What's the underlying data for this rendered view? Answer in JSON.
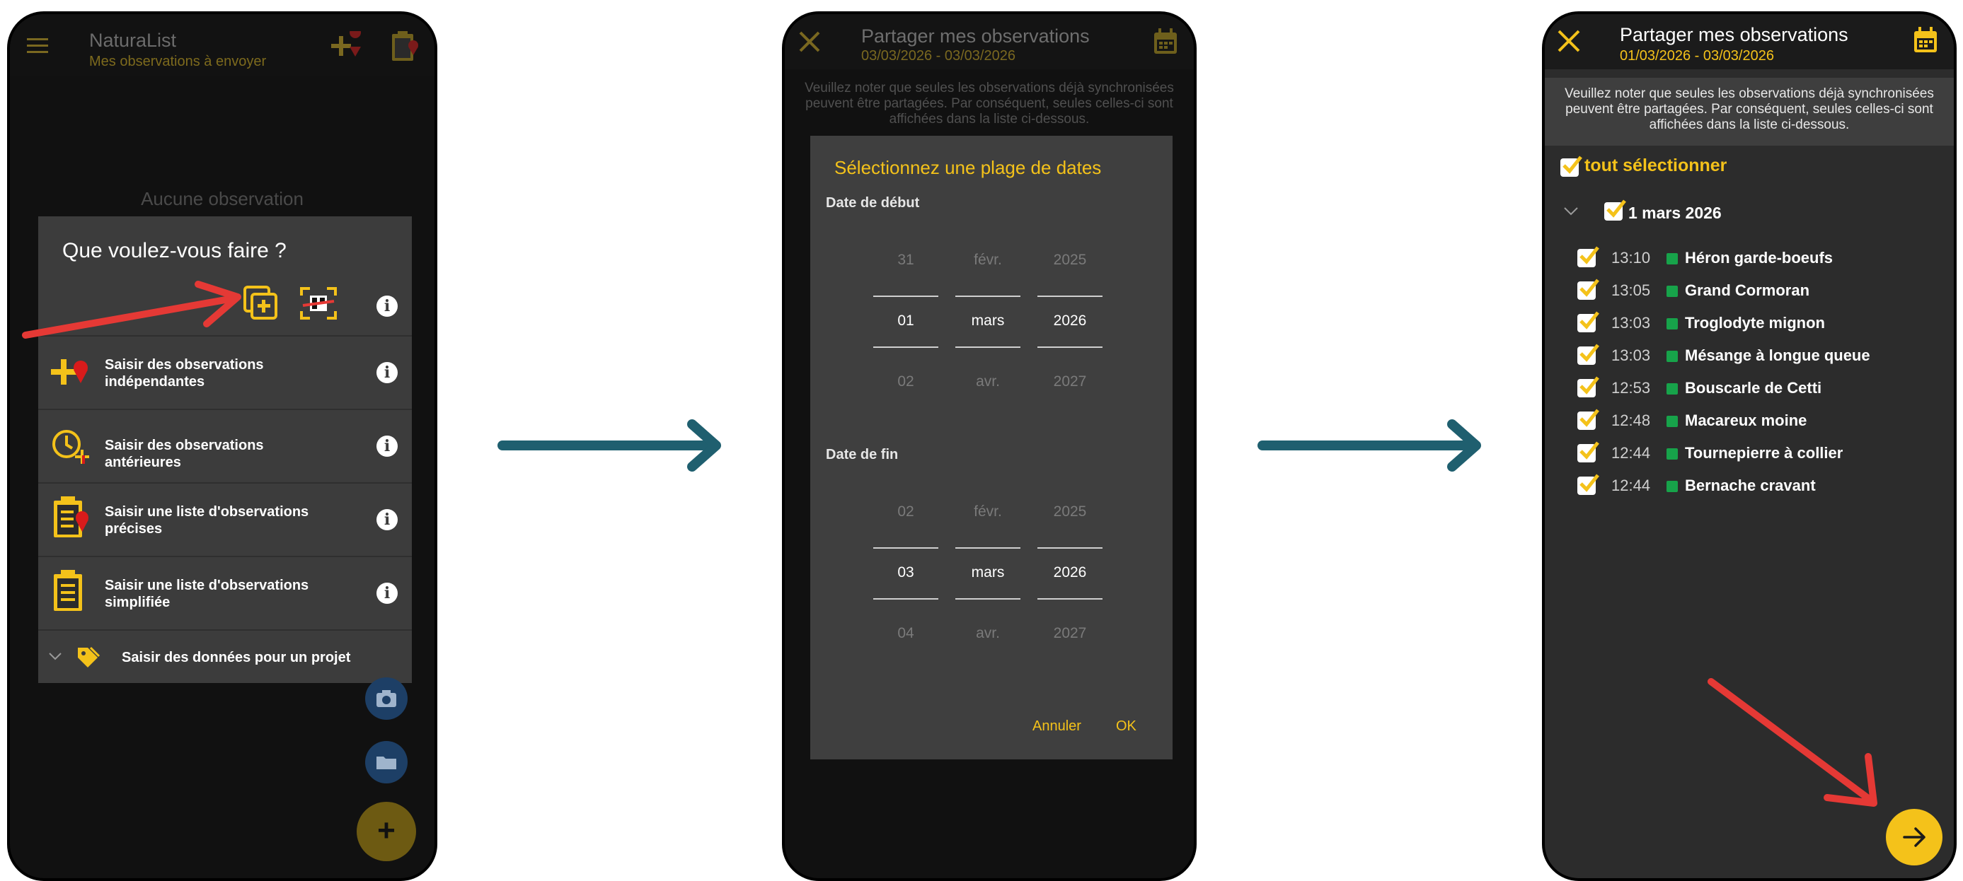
{
  "colors": {
    "accent": "#f4c21a",
    "flow_arrow": "#1f5f6f",
    "annotation": "#e53935",
    "species_marker": "#17a34a"
  },
  "screen1": {
    "app_title": "NaturaList",
    "subtitle": "Mes observations à envoyer",
    "empty_text": "Aucune observation",
    "dialog_title": "Que voulez-vous faire ?",
    "options": [
      {
        "label": "Saisir des observations indépendantes",
        "icon": "add-pin-icon"
      },
      {
        "label": "Saisir des observations antérieures",
        "icon": "clock-add-icon"
      },
      {
        "label": "Saisir une liste d'observations précises",
        "icon": "clipboard-pin-icon"
      },
      {
        "label": "Saisir une liste d'observations simplifiée",
        "icon": "clipboard-icon"
      }
    ],
    "project_label": "Saisir des données pour un projet",
    "fab_label": "+"
  },
  "screen2": {
    "title": "Partager mes observations",
    "date_range": "03/03/2026 - 03/03/2026",
    "notice": "Veuillez noter que seules les observations déjà synchronisées peuvent être partagées. Par conséquent, seules celles-ci sont affichées dans la liste ci-dessous.",
    "dialog_title": "Sélectionnez une plage de dates",
    "start_label": "Date de début",
    "start": {
      "day": [
        "31",
        "01",
        "02"
      ],
      "month": [
        "févr.",
        "mars",
        "avr."
      ],
      "year": [
        "2025",
        "2026",
        "2027"
      ]
    },
    "end_label": "Date de fin",
    "end": {
      "day": [
        "02",
        "03",
        "04"
      ],
      "month": [
        "févr.",
        "mars",
        "avr."
      ],
      "year": [
        "2025",
        "2026",
        "2027"
      ]
    },
    "cancel_label": "Annuler",
    "ok_label": "OK"
  },
  "screen3": {
    "title": "Partager mes observations",
    "date_range": "01/03/2026 - 03/03/2026",
    "notice": "Veuillez noter que seules les observations déjà synchronisées peuvent être partagées. Par conséquent, seules celles-ci sont affichées dans la liste ci-dessous.",
    "select_all": "tout sélectionner",
    "group_label": "1 mars 2026",
    "observations": [
      {
        "time": "13:10",
        "name": "Héron garde-boeufs"
      },
      {
        "time": "13:05",
        "name": "Grand Cormoran"
      },
      {
        "time": "13:03",
        "name": "Troglodyte mignon"
      },
      {
        "time": "13:03",
        "name": "Mésange à longue queue"
      },
      {
        "time": "12:53",
        "name": "Bouscarle de Cetti"
      },
      {
        "time": "12:48",
        "name": "Macareux moine"
      },
      {
        "time": "12:44",
        "name": "Tournepierre à collier"
      },
      {
        "time": "12:44",
        "name": "Bernache cravant"
      }
    ]
  }
}
